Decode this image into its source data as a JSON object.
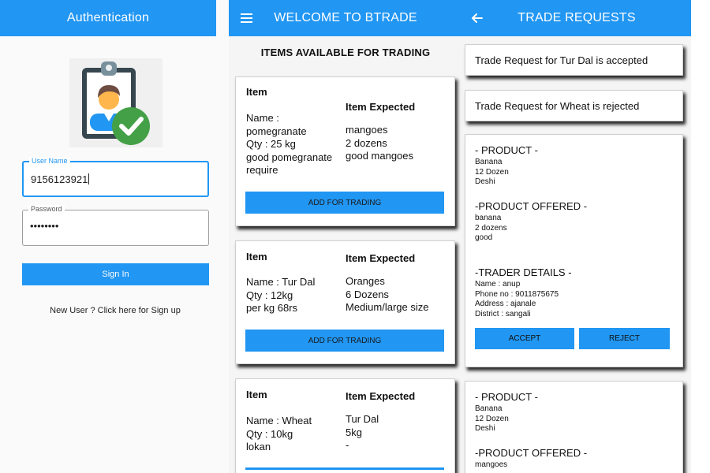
{
  "colors": {
    "primary": "#2196f3",
    "background": "#f5f5f5"
  },
  "auth": {
    "title": "Authentication",
    "username_label": "User Name",
    "username_value": "9156123921",
    "password_label": "Password",
    "password_value": "••••••••",
    "signin_label": "Sign In",
    "signup_text": "New User ? Click here for Sign up",
    "logo_icon": "user-verified-icon"
  },
  "trade": {
    "title": "WELCOME TO BTRADE",
    "menu_icon": "hamburger-menu-icon",
    "section_title": "ITEMS AVAILABLE FOR TRADING",
    "items": [
      {
        "item_heading": "Item",
        "item_text": "Name :\npomegranate\nQty : 25 kg\ngood pomegranate\nrequire",
        "expected_heading": "Item Expected",
        "expected_text": "mangoes\n2 dozens\ngood mangoes",
        "button": "ADD FOR TRADING"
      },
      {
        "item_heading": "Item",
        "item_text": "Name : Tur Dal\nQty : 12kg\nper kg 68rs",
        "expected_heading": "Item Expected",
        "expected_text": "Oranges\n6 Dozens\nMedium/large size",
        "button": "ADD FOR TRADING"
      },
      {
        "item_heading": "Item",
        "item_text": "Name : Wheat\nQty : 10kg\nlokan",
        "expected_heading": "Item Expected",
        "expected_text": "Tur Dal\n5kg\n-"
      }
    ]
  },
  "requests": {
    "title": "TRADE REQUESTS",
    "back_icon": "arrow-back-icon",
    "statuses": [
      "Trade Request for Tur Dal is accepted",
      "Trade Request for Wheat is rejected"
    ],
    "cards": [
      {
        "product_heading": "- PRODUCT -",
        "product_lines": "Banana\n12 Dozen\nDeshi",
        "offered_heading": "-PRODUCT OFFERED -",
        "offered_lines": "banana\n2 dozens\ngood",
        "trader_heading": "-TRADER DETAILS -",
        "trader_lines": "Name : anup\nPhone no : 9011875675\nAddress : ajanale\nDistrict : sangali",
        "accept": "ACCEPT",
        "reject": "REJECT"
      },
      {
        "product_heading": "- PRODUCT -",
        "product_lines": "Banana\n12 Dozen\nDeshi",
        "offered_heading": "-PRODUCT OFFERED -",
        "offered_lines": "mangoes"
      }
    ]
  }
}
